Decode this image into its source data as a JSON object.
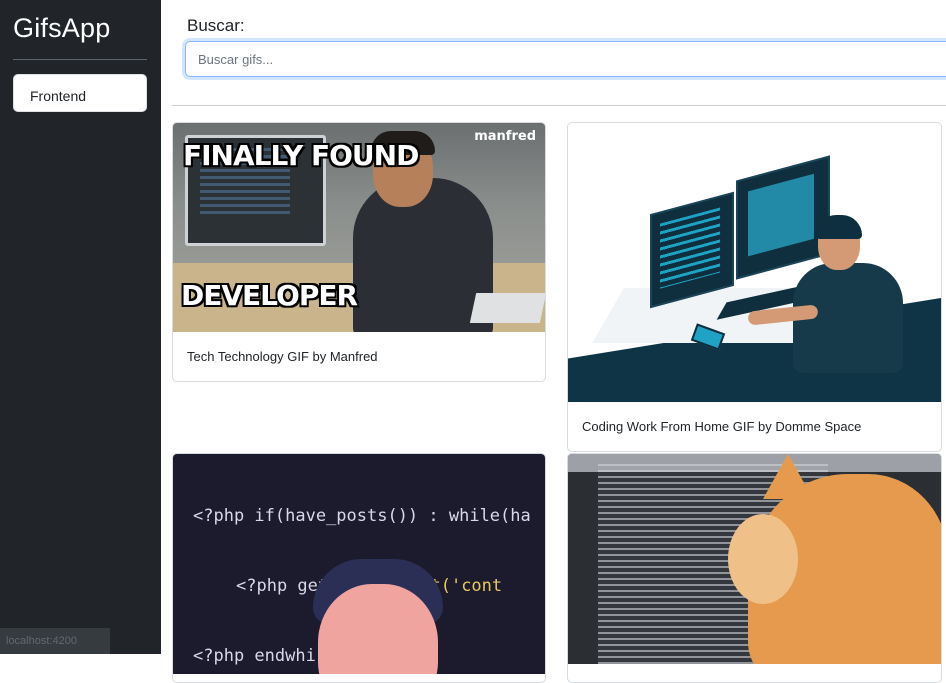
{
  "app": {
    "title": "GifsApp"
  },
  "sidebar": {
    "history": [
      {
        "label": "Frontend"
      }
    ],
    "footer_text": "localhost:4200"
  },
  "search": {
    "label": "Buscar:",
    "placeholder": "Buscar gifs...",
    "value": ""
  },
  "gifs": [
    {
      "title": "Tech Technology GIF by Manfred",
      "overlay_top": "FINALLY FOUND",
      "overlay_bottom": "DEVELOPER",
      "watermark": "manfred"
    },
    {
      "title": "Coding Work From Home GIF by Domme Space"
    },
    {
      "title": "",
      "code_lines": [
        "<?php if(have_posts()) : while(ha",
        "<?php get",
        "part('cont",
        "<?php endwhi"
      ]
    },
    {
      "title": ""
    }
  ],
  "colors": {
    "sidebar_bg": "#212529",
    "accent_focus": "#86b7fe"
  }
}
